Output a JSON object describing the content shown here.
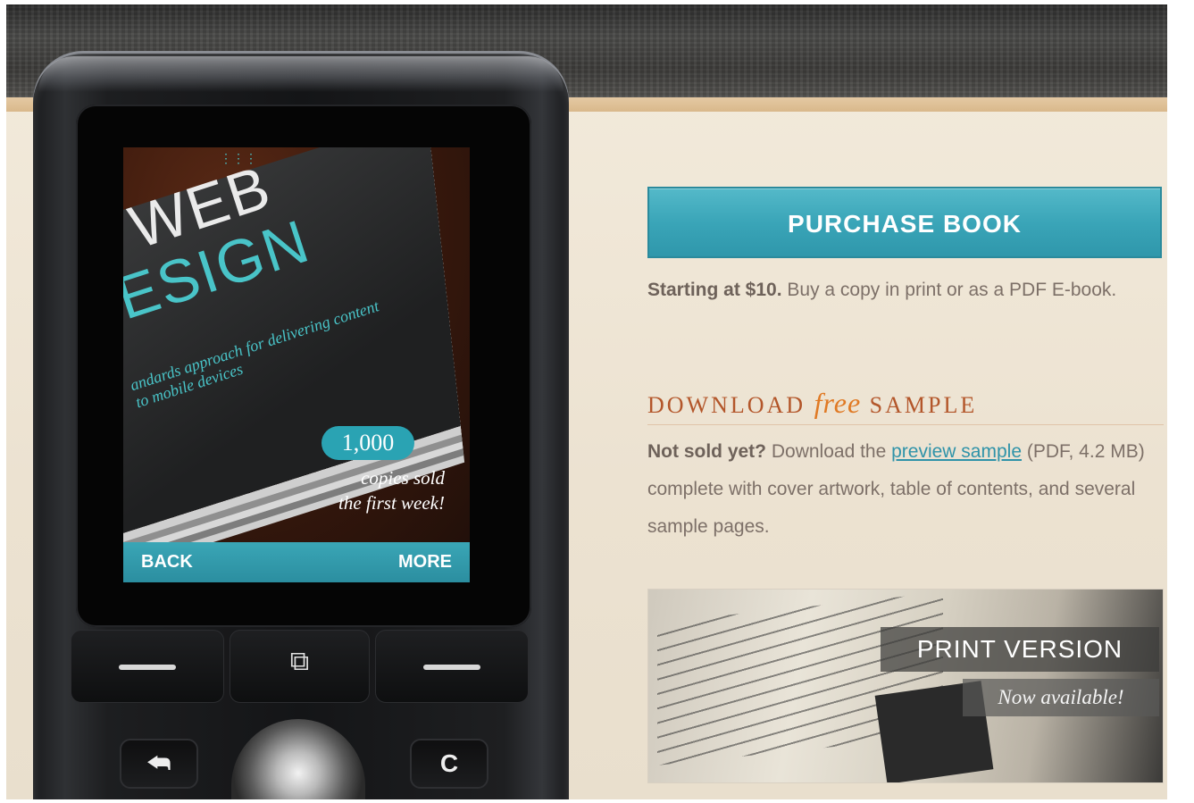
{
  "phone": {
    "book_title_line1": "WEB",
    "book_title_line2": "ESIGN",
    "book_subtitle": "andards approach for delivering content to mobile devices",
    "badge_number": "1,000",
    "badge_text_line1": "copies sold",
    "badge_text_line2": "the first week!",
    "nav_back": "BACK",
    "nav_more": "MORE",
    "key_c": "C"
  },
  "purchase": {
    "button_label": "PURCHASE BOOK",
    "price_bold": "Starting at $10.",
    "price_text": " Buy a copy in print or as a PDF E-book."
  },
  "download": {
    "heading_part1": "DOWNLOAD ",
    "heading_free": "free",
    "heading_part2": " SAMPLE",
    "lead_bold": "Not sold yet?",
    "text_before_link": " Download the ",
    "link_text": "preview sample",
    "text_after_link": " (PDF, 4.2 MB) complete with cover artwork, table of contents, and several sample pages."
  },
  "print_promo": {
    "title": "PRINT VERSION",
    "subtitle": "Now available!"
  },
  "colors": {
    "accent_teal": "#3aa5b8",
    "heading_orange": "#b3562a",
    "free_orange": "#e07a25",
    "link_blue": "#2f93a9"
  }
}
